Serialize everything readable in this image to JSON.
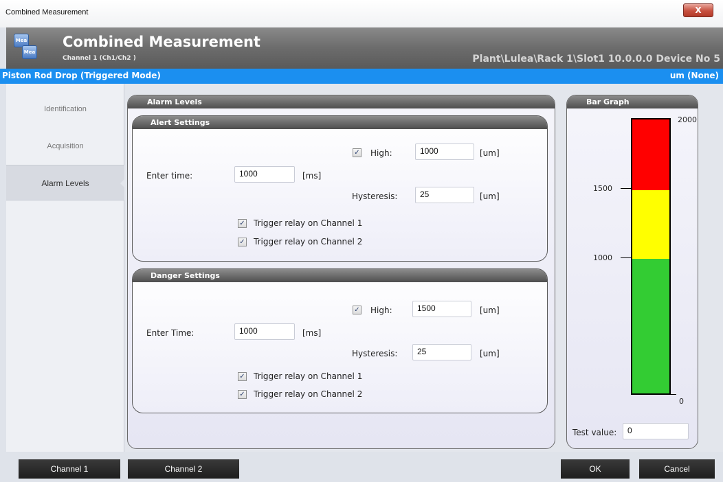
{
  "window": {
    "title": "Combined Measurement",
    "close_label": "X"
  },
  "header": {
    "title": "Combined Measurement",
    "subtitle": "Channel 1 (Ch1/Ch2 )",
    "path": "Plant\\Lulea\\Rack 1\\Slot1 10.0.0.0 Device No 5",
    "logo_text_1": "Mea",
    "logo_text_2": "Mea"
  },
  "bluebar": {
    "left": "Piston Rod Drop (Triggered Mode)",
    "right": "um (None)"
  },
  "nav": {
    "items": [
      {
        "label": "Identification"
      },
      {
        "label": "Acquisition"
      },
      {
        "label": "Alarm Levels"
      }
    ]
  },
  "alarm_levels": {
    "title": "Alarm Levels",
    "alert": {
      "title": "Alert Settings",
      "high_label": "High:",
      "high_checked": true,
      "high_value": "1000",
      "high_unit": "[um]",
      "enter_time_label": "Enter time:",
      "enter_time_value": "1000",
      "enter_time_unit": "[ms]",
      "hysteresis_label": "Hysteresis:",
      "hysteresis_value": "25",
      "hysteresis_unit": "[um]",
      "relay1_label": "Trigger relay on Channel 1",
      "relay2_label": "Trigger relay on Channel 2"
    },
    "danger": {
      "title": "Danger Settings",
      "high_label": "High:",
      "high_checked": true,
      "high_value": "1500",
      "high_unit": "[um]",
      "enter_time_label": "Enter Time:",
      "enter_time_value": "1000",
      "enter_time_unit": "[ms]",
      "hysteresis_label": "Hysteresis:",
      "hysteresis_value": "25",
      "hysteresis_unit": "[um]",
      "relay1_label": "Trigger relay on Channel 1",
      "relay2_label": "Trigger relay on Channel 2"
    }
  },
  "bar_graph": {
    "title": "Bar Graph",
    "scale_max": "2000",
    "tick_1500": "1500",
    "tick_1000": "1000",
    "scale_min": "0",
    "danger_level": 1500,
    "alert_level": 1000,
    "colors": {
      "danger": "#ff0000",
      "alert": "#ffff00",
      "ok": "#33cc33"
    },
    "test_value_label": "Test value:",
    "test_value": "0"
  },
  "footer": {
    "channel1": "Channel 1",
    "channel2": "Channel 2",
    "ok": "OK",
    "cancel": "Cancel"
  }
}
